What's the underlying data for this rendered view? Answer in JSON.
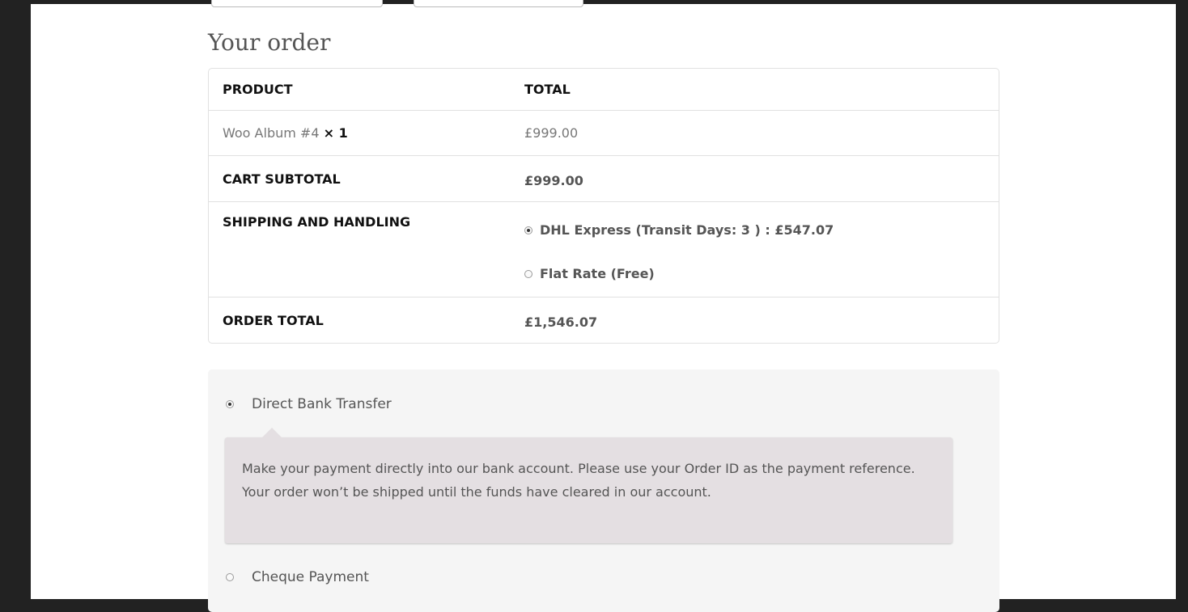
{
  "heading": "Your order",
  "table": {
    "col_product": "PRODUCT",
    "col_total": "TOTAL",
    "item": {
      "name": "Woo Album #4",
      "qty": "× 1",
      "price": "£999.00"
    },
    "subtotal": {
      "label": "CART SUBTOTAL",
      "value": "£999.00"
    },
    "shipping": {
      "label": "SHIPPING AND HANDLING",
      "options": [
        {
          "label": "DHL Express (Transit Days: 3 ) : £547.07",
          "selected": true
        },
        {
          "label": "Flat Rate (Free)",
          "selected": false
        }
      ]
    },
    "total": {
      "label": "ORDER TOTAL",
      "value": "£1,546.07"
    }
  },
  "payment": {
    "methods": [
      {
        "label": "Direct Bank Transfer",
        "selected": true
      },
      {
        "label": "Cheque Payment",
        "selected": false
      }
    ],
    "description": "Make your payment directly into our bank account. Please use your Order ID as the payment reference. Your order won’t be shipped until the funds have cleared in our account."
  }
}
